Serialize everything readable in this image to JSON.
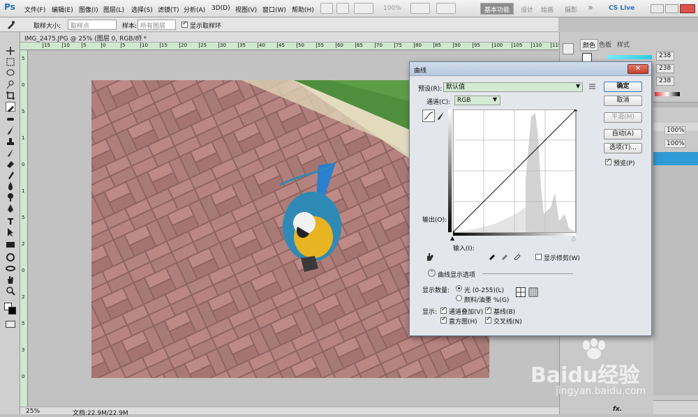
{
  "app": {
    "logo": "Ps"
  },
  "menu": [
    "文件(F)",
    "编辑(E)",
    "图像(I)",
    "图层(L)",
    "选择(S)",
    "滤镜(T)",
    "分析(A)",
    "3D(D)",
    "视图(V)",
    "窗口(W)",
    "帮助(H)"
  ],
  "toolbar_top": {
    "zoom": "100%",
    "workspace_active": "基本功能",
    "workspaces": [
      "设计",
      "绘画",
      "摄影"
    ],
    "more": "»",
    "cslive": "CS Live"
  },
  "options_bar": {
    "sample_size_label": "取样大小:",
    "sample_size_value": "取样点",
    "sample_label": "样本:",
    "sample_value": "所有图层",
    "show_ring_label": "显示取样环"
  },
  "document": {
    "tab_title": "IMG_2475.JPG @ 25% (图层 0, RGB/8) *",
    "zoom": "25%",
    "doc_info": "文档:22.9M/22.9M",
    "ruler_h": [
      "15",
      "10",
      "5",
      "0",
      "5",
      "10",
      "15",
      "20",
      "25",
      "30",
      "35",
      "40",
      "45",
      "50",
      "55",
      "60",
      "65",
      "70",
      "75",
      "80",
      "85",
      "90",
      "95",
      "100",
      "105",
      "110",
      "115"
    ],
    "ruler_v": [
      "5",
      "0",
      "5",
      "1",
      "0",
      "1",
      "5",
      "2",
      "0",
      "2",
      "5",
      "3",
      "0"
    ]
  },
  "panels": {
    "tabs": [
      "颜色",
      "色板",
      "样式"
    ],
    "values": [
      "238",
      "238",
      "238"
    ],
    "opacity": [
      "100%",
      "100%"
    ],
    "fill": [
      "100%",
      "100%"
    ]
  },
  "dialog": {
    "title": "曲线",
    "preset_label": "预设(R):",
    "preset_value": "默认值",
    "channel_label": "通道(C):",
    "channel_value": "RGB",
    "output_label": "输出(O):",
    "input_label": "输入(I):",
    "show_clipping": "显示修剪(W)",
    "curve_options": "曲线显示选项",
    "show_amount_label": "显示数量:",
    "light_option": "光 (0-255)(L)",
    "pigment_option": "颜料/油墨 %(G)",
    "show_label": "显示:",
    "overlay": "通道叠加(V)",
    "baseline": "基线(B)",
    "histogram": "直方图(H)",
    "intersection": "交叉线(N)",
    "buttons": {
      "ok": "确定",
      "cancel": "取消",
      "smooth": "平滑(M)",
      "auto": "自动(A)",
      "options": "选项(T)...",
      "preview": "预览(P)"
    }
  },
  "watermark": {
    "text": "Baidu经验",
    "url": "jingyan.baidu.com"
  },
  "colors": {
    "accent": "#2a6fba",
    "selected_layer": "#2f9bd6",
    "dialog_bg": "#e3e6ea"
  }
}
